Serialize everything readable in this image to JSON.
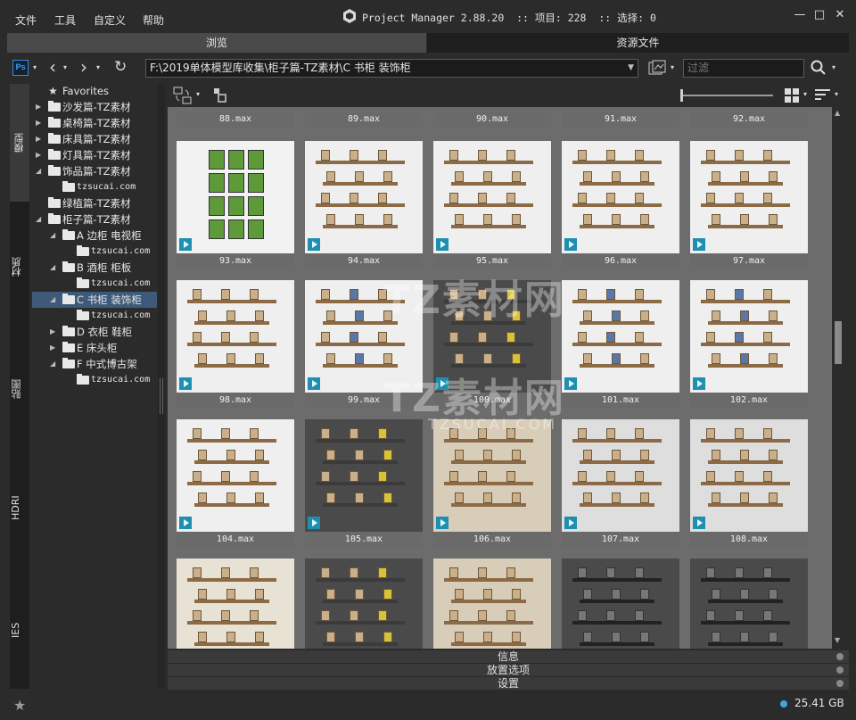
{
  "menu": [
    "文件",
    "工具",
    "自定义",
    "帮助"
  ],
  "title": "Project Manager 2.88.20  :: 项目: 228  :: 选择: 0",
  "window_controls": [
    "minimize-icon",
    "maximize-icon",
    "close-icon"
  ],
  "tabs": {
    "browse": "浏览",
    "assets": "资源文件"
  },
  "toolbar": {
    "ps_label": "Ps",
    "path": "F:\\2019单体模型库收集\\柜子篇-TZ素材\\C 书柜 装饰柜",
    "filter_placeholder": "过滤"
  },
  "vtabs": [
    "模型",
    "材质",
    "贴图",
    "HDRI",
    "IES"
  ],
  "tree": [
    {
      "label": "Favorites",
      "level": 0,
      "arrow": "",
      "icon": "star"
    },
    {
      "label": "沙发篇-TZ素材",
      "level": 0,
      "arrow": "▶",
      "icon": "folder"
    },
    {
      "label": "桌椅篇-TZ素材",
      "level": 0,
      "arrow": "▶",
      "icon": "folder"
    },
    {
      "label": "床具篇-TZ素材",
      "level": 0,
      "arrow": "▶",
      "icon": "folder"
    },
    {
      "label": "灯具篇-TZ素材",
      "level": 0,
      "arrow": "▶",
      "icon": "folder"
    },
    {
      "label": "饰品篇-TZ素材",
      "level": 0,
      "arrow": "◢",
      "icon": "folder"
    },
    {
      "label": "tzsucai.com",
      "level": 1,
      "arrow": "",
      "icon": "folder"
    },
    {
      "label": "绿植篇-TZ素材",
      "level": 0,
      "arrow": "",
      "icon": "folder"
    },
    {
      "label": "柜子篇-TZ素材",
      "level": 0,
      "arrow": "◢",
      "icon": "folder"
    },
    {
      "label": "A 边柜 电视柜",
      "level": 1,
      "arrow": "◢",
      "icon": "folder"
    },
    {
      "label": "tzsucai.com",
      "level": 2,
      "arrow": "",
      "icon": "folder"
    },
    {
      "label": "B 酒柜 柜板",
      "level": 1,
      "arrow": "◢",
      "icon": "folder"
    },
    {
      "label": "tzsucai.com",
      "level": 2,
      "arrow": "",
      "icon": "folder"
    },
    {
      "label": "C 书柜 装饰柜",
      "level": 1,
      "arrow": "◢",
      "icon": "folder",
      "selected": true
    },
    {
      "label": "tzsucai.com",
      "level": 2,
      "arrow": "",
      "icon": "folder"
    },
    {
      "label": "D 衣柜 鞋柜",
      "level": 1,
      "arrow": "▶",
      "icon": "folder"
    },
    {
      "label": "E 床头柜",
      "level": 1,
      "arrow": "▶",
      "icon": "folder"
    },
    {
      "label": "F 中式博古架",
      "level": 1,
      "arrow": "◢",
      "icon": "folder"
    },
    {
      "label": "tzsucai.com",
      "level": 2,
      "arrow": "",
      "icon": "folder"
    }
  ],
  "top_row": [
    "88.max",
    "89.max",
    "90.max",
    "91.max",
    "92.max"
  ],
  "items": [
    "93.max",
    "94.max",
    "95.max",
    "96.max",
    "97.max",
    "98.max",
    "99.max",
    "100.max",
    "101.max",
    "102.max",
    "104.max",
    "105.max",
    "106.max",
    "107.max",
    "108.max",
    "",
    "",
    "",
    "",
    ""
  ],
  "watermark": {
    "line1": "TZ素材网",
    "line2": "TZ素材网",
    "line3": "TZSUCAI.COM"
  },
  "bottom_panels": [
    "信息",
    "放置选项",
    "设置"
  ],
  "status": {
    "disk": "25.41 GB"
  },
  "colors": {
    "accent": "#3aa7e6",
    "selection": "#3e5a7a",
    "badge": "#1e8fb0"
  }
}
